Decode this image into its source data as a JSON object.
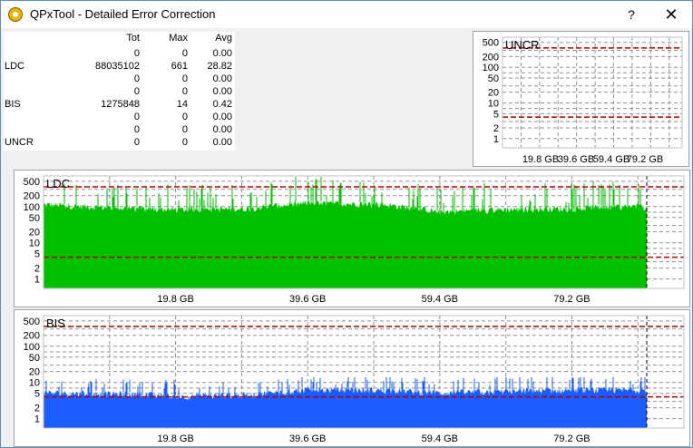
{
  "window": {
    "title": "QPxTool - Detailed Error Correction",
    "help_label": "?",
    "close_label": "✕"
  },
  "stats": {
    "headers": {
      "label": "",
      "tot": "Tot",
      "max": "Max",
      "avg": "Avg"
    },
    "rows": [
      {
        "label": "",
        "tot": "0",
        "max": "0",
        "avg": "0.00"
      },
      {
        "label": "LDC",
        "tot": "88035102",
        "max": "661",
        "avg": "28.82"
      },
      {
        "label": "",
        "tot": "0",
        "max": "0",
        "avg": "0.00"
      },
      {
        "label": "",
        "tot": "0",
        "max": "0",
        "avg": "0.00"
      },
      {
        "label": "BIS",
        "tot": "1275848",
        "max": "14",
        "avg": "0.42"
      },
      {
        "label": "",
        "tot": "0",
        "max": "0",
        "avg": "0.00"
      },
      {
        "label": "",
        "tot": "0",
        "max": "0",
        "avg": "0.00"
      },
      {
        "label": "UNCR",
        "tot": "0",
        "max": "0",
        "avg": "0.00"
      }
    ]
  },
  "colors": {
    "ldc": "#00c000",
    "bis": "#1a5cff",
    "threshold": "#b00000",
    "grid": "#808080"
  },
  "chart_data": [
    {
      "type": "area",
      "title": "UNCR",
      "y_ticks": [
        "500",
        "200",
        "100",
        "50",
        "20",
        "10",
        "5",
        "2",
        "1"
      ],
      "y_scale": "log",
      "x_ticks": [
        "19.8 GB",
        "39.6 GB",
        "59.4 GB",
        "79.2 GB"
      ],
      "series": []
    },
    {
      "type": "area",
      "title": "LDC",
      "y_ticks": [
        "500",
        "200",
        "100",
        "50",
        "20",
        "10",
        "5",
        "2",
        "1"
      ],
      "y_scale": "log",
      "x_ticks": [
        "19.8 GB",
        "39.6 GB",
        "59.4 GB",
        "79.2 GB"
      ],
      "series": [
        {
          "profile": [
            [
              0,
              110
            ],
            [
              8,
              95
            ],
            [
              14,
              85
            ],
            [
              19.8,
              80
            ],
            [
              30,
              85
            ],
            [
              39.6,
              120
            ],
            [
              50,
              115
            ],
            [
              59.4,
              70
            ],
            [
              68,
              80
            ],
            [
              79.2,
              85
            ],
            [
              85,
              95
            ],
            [
              96,
              95
            ]
          ],
          "peak": 661
        }
      ]
    },
    {
      "type": "area",
      "title": "BIS",
      "y_ticks": [
        "500",
        "200",
        "100",
        "50",
        "20",
        "10",
        "5",
        "2",
        "1"
      ],
      "y_scale": "log",
      "x_ticks": [
        "19.8 GB",
        "39.6 GB",
        "59.4 GB",
        "79.2 GB"
      ],
      "series": [
        {
          "profile": [
            [
              0,
              5
            ],
            [
              14,
              4.6
            ],
            [
              19.8,
              4
            ],
            [
              30,
              4.3
            ],
            [
              39.6,
              6
            ],
            [
              50,
              6
            ],
            [
              59.4,
              5
            ],
            [
              79.2,
              6
            ],
            [
              96,
              6
            ]
          ],
          "peak": 14
        }
      ]
    }
  ]
}
